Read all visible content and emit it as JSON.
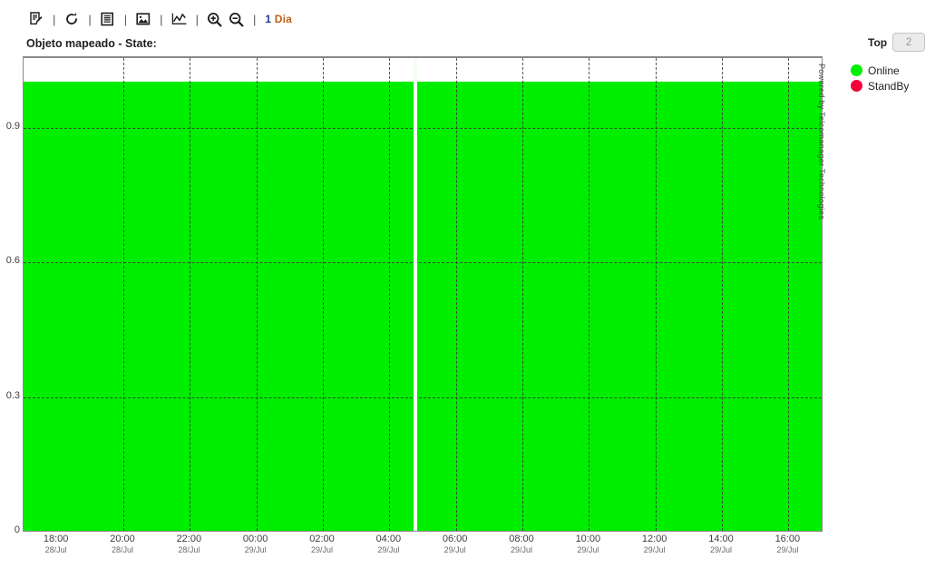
{
  "toolbar": {
    "icons": [
      {
        "name": "edit-report-icon",
        "label": "Editar"
      },
      {
        "name": "refresh-icon",
        "label": "Atualizar"
      },
      {
        "name": "table-view-icon",
        "label": "Tabela"
      },
      {
        "name": "image-export-icon",
        "label": "Imagem"
      },
      {
        "name": "line-chart-icon",
        "label": "Gráfico"
      },
      {
        "name": "zoom-in-icon",
        "label": "Zoom +"
      },
      {
        "name": "zoom-out-icon",
        "label": "Zoom -"
      }
    ],
    "separator": "|",
    "range_number": "1",
    "range_unit": "Dia"
  },
  "chart_title": "Objeto mapeado - State:",
  "watermark": "Powered by Telcomanager Technologies",
  "top_control": {
    "label": "Top",
    "value": "2"
  },
  "legend": {
    "items": [
      {
        "label": "Online",
        "color": "#00ee00"
      },
      {
        "label": "StandBy",
        "color": "#f5003c"
      }
    ]
  },
  "chart_data": {
    "type": "area",
    "title": "Objeto mapeado - State:",
    "xlabel": "",
    "ylabel": "",
    "ylim": [
      0,
      1.0
    ],
    "yticks": [
      0,
      0.3,
      0.6,
      0.9
    ],
    "ytick_labels": [
      "0",
      "0.3",
      "0.6",
      "0.9"
    ],
    "grid": true,
    "legend_position": "right",
    "x_tick_labels": [
      {
        "time": "18:00",
        "date": "28/Jul"
      },
      {
        "time": "20:00",
        "date": "28/Jul"
      },
      {
        "time": "22:00",
        "date": "28/Jul"
      },
      {
        "time": "00:00",
        "date": "29/Jul"
      },
      {
        "time": "02:00",
        "date": "29/Jul"
      },
      {
        "time": "04:00",
        "date": "29/Jul"
      },
      {
        "time": "06:00",
        "date": "29/Jul"
      },
      {
        "time": "08:00",
        "date": "29/Jul"
      },
      {
        "time": "10:00",
        "date": "29/Jul"
      },
      {
        "time": "12:00",
        "date": "29/Jul"
      },
      {
        "time": "14:00",
        "date": "29/Jul"
      },
      {
        "time": "16:00",
        "date": "29/Jul"
      }
    ],
    "series": [
      {
        "name": "Online",
        "color": "#00ee00",
        "segments": [
          {
            "start_pct": 0.0,
            "end_pct": 48.9,
            "value": 1.0
          },
          {
            "start_pct": 49.3,
            "end_pct": 100.0,
            "value": 1.0
          }
        ]
      },
      {
        "name": "StandBy",
        "color": "#f5003c",
        "segments": []
      }
    ],
    "gap": {
      "start_pct": 48.9,
      "end_pct": 49.3,
      "note": "no data"
    }
  }
}
